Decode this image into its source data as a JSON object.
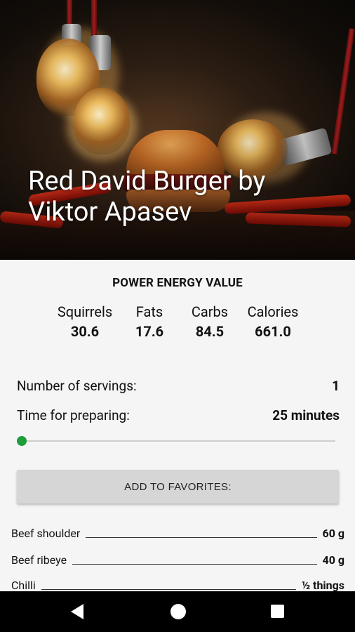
{
  "recipe": {
    "title": "Red David Burger by Viktor Apasev"
  },
  "energy": {
    "heading": "POWER ENERGY VALUE",
    "nutrients": [
      {
        "label": "Squirrels",
        "value": "30.6"
      },
      {
        "label": "Fats",
        "value": "17.6"
      },
      {
        "label": "Carbs",
        "value": "84.5"
      },
      {
        "label": "Calories",
        "value": "661.0"
      }
    ]
  },
  "servings": {
    "label": "Number of servings:",
    "value": "1"
  },
  "prep_time": {
    "label": "Time for preparing:",
    "value": "25 minutes"
  },
  "servings_slider": {
    "level": 0.0,
    "accent_color": "#1e9e3a"
  },
  "favorites_button": {
    "label": "ADD TO FAVORITES:"
  },
  "ingredients": [
    {
      "name": "Beef shoulder",
      "amount": "60 g"
    },
    {
      "name": "Beef ribeye",
      "amount": "40 g"
    },
    {
      "name": "Chilli",
      "amount": "½ things"
    }
  ],
  "nav": {
    "back_icon": "back-triangle-icon",
    "home_icon": "home-circle-icon",
    "recents_icon": "recents-square-icon"
  }
}
